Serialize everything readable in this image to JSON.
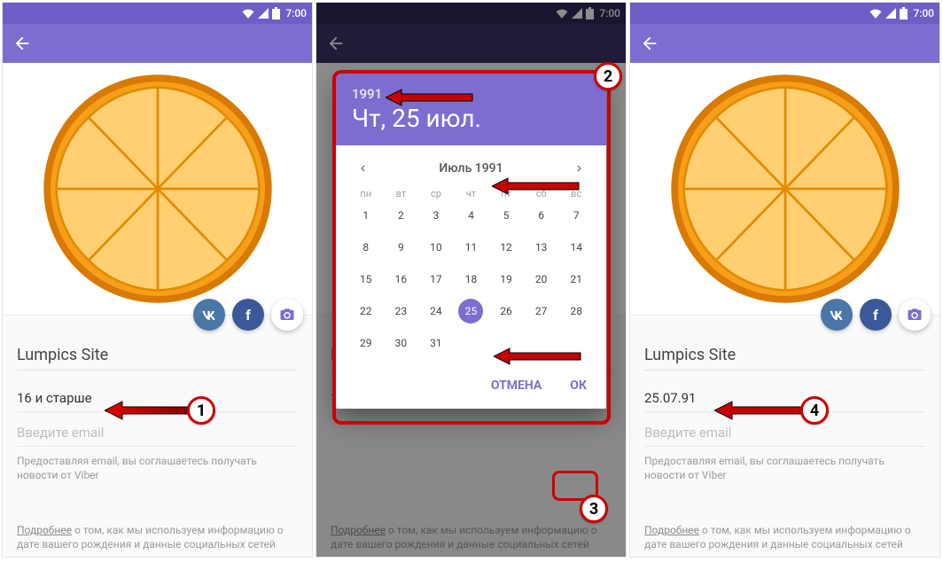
{
  "status": {
    "time": "7:00"
  },
  "profile": {
    "name": "Lumpics Site",
    "age_line_left": "16 и старше",
    "age_line_right": "25.07.91",
    "email_placeholder": "Введите email",
    "email_disclaimer": "Предоставляя email, вы соглашаетесь получать новости от Viber",
    "more_label": "Подробнее",
    "more_text": " о том, как мы используем информацию о дате вашего рождения и данные социальных сетей"
  },
  "datepicker": {
    "year": "1991",
    "date_line": "Чт, 25 июл.",
    "month_label": "Июль 1991",
    "dow": [
      "пн",
      "вт",
      "ср",
      "чт",
      "пт",
      "сб",
      "вс"
    ],
    "days": [
      1,
      2,
      3,
      4,
      5,
      6,
      7,
      8,
      9,
      10,
      11,
      12,
      13,
      14,
      15,
      16,
      17,
      18,
      19,
      20,
      21,
      22,
      23,
      24,
      25,
      26,
      27,
      28,
      29,
      30,
      31
    ],
    "selected": 25,
    "cancel": "ОТМЕНА",
    "ok": "ОК"
  },
  "steps": {
    "s1": "1",
    "s2": "2",
    "s3": "3",
    "s4": "4"
  }
}
